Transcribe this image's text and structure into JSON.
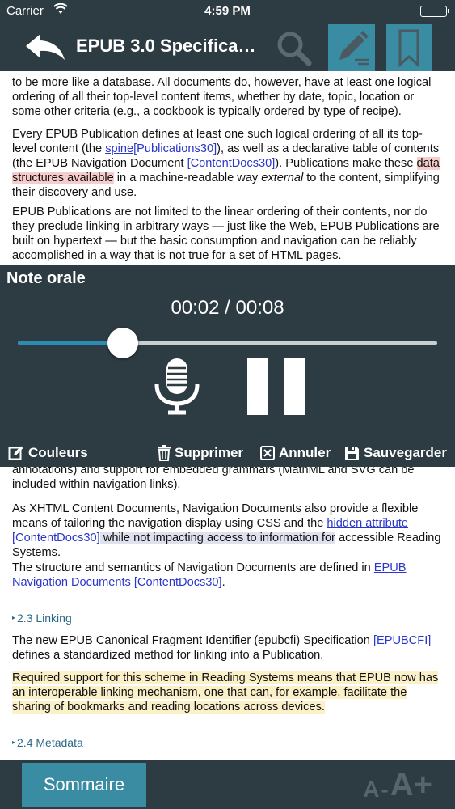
{
  "status": {
    "carrier": "Carrier",
    "time": "4:59 PM"
  },
  "nav": {
    "title": "EPUB 3.0 Specifica…"
  },
  "content": {
    "p1": "to be more like a database. All documents do, however, have at least one logical ordering of all their top-level content items, whether by date, topic, location or some other criteria (e.g., a cookbook is typically ordered by type of recipe).",
    "p2": {
      "a": "Every EPUB Publication defines at least one such logical ordering of all its top-level content (the ",
      "spine": "spine",
      "ref1": "[Publications30]",
      "b": "), as well as a declarative table of contents (the EPUB Navigation Document ",
      "ref2": "[ContentDocs30]",
      "c": "). Publications make these ",
      "highlight": "data structures available",
      "d": " in a machine-readable way ",
      "em": "external",
      "e": " to the content, simplifying their discovery and use."
    },
    "p3": "EPUB Publications are not limited to the linear ordering of their contents, nor do they preclude linking in arbitrary ways — just like the Web, EPUB Publications are built on hypertext — but the basic consumption and navigation can be reliably accomplished in a way that is not true for a set of HTML pages.",
    "p4": "annotations) and support for embedded grammars (MathML and SVG can be included within navigation links).",
    "p5": {
      "a": "As XHTML Content Documents, Navigation Documents also provide a flexible means of tailoring the navigation display using CSS and the ",
      "link": "hidden attribute",
      "ref": "[ContentDocs30]",
      "highlight": " while not impacting access to information for",
      "b": " accessible Reading Systems."
    },
    "p6": {
      "a": "The structure and semantics of Navigation Documents are defined in ",
      "link": "EPUB Navigation Documents",
      "ref": " [ContentDocs30]",
      "b": "."
    },
    "section_linking": "2.3 Linking",
    "p7": {
      "a": "The new EPUB Canonical Fragment Identifier (epubcfi) Specification ",
      "ref": "[EPUBCFI]",
      "b": " defines a standardized method for linking into a Publication."
    },
    "p8": "Required support for this scheme in Reading Systems means that EPUB now has an interoperable linking mechanism, one that can, for example, facilitate the sharing of bookmarks and reading locations across devices.",
    "section_metadata": "2.4 Metadata"
  },
  "note": {
    "title": "Note orale",
    "time": "00:02 / 00:08",
    "progress": 0.25,
    "actions": {
      "colors": "Couleurs",
      "delete": "Supprimer",
      "cancel": "Annuler",
      "save": "Sauvegarder"
    }
  },
  "bottom": {
    "summary": "Sommaire",
    "font_small": "A",
    "font_sep": "-",
    "font_large": "A+"
  },
  "colors": {
    "bar": "#2d3b42",
    "accent": "#3a8ca3",
    "link": "#2a37c8",
    "highlight_red": "#f6cccc",
    "highlight_yellow": "#fbf0c8",
    "highlight_gray": "#dfe1ee"
  },
  "icons": [
    "back-arrow-icon",
    "search-icon",
    "edit-note-icon",
    "bookmark-icon",
    "microphone-icon",
    "pause-icon",
    "edit-icon",
    "trash-icon",
    "close-box-icon",
    "floppy-disk-icon"
  ]
}
